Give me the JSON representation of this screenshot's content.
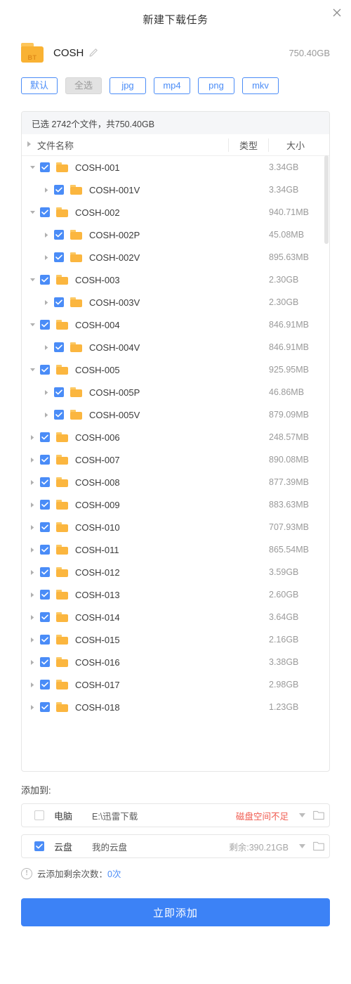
{
  "dialog": {
    "title": "新建下载任务",
    "close_icon": "close-icon"
  },
  "torrent": {
    "icon_label": "BT",
    "name": "COSH",
    "edit_icon": "pencil-icon",
    "total_size": "750.40GB"
  },
  "filters": [
    {
      "label": "默认",
      "state": "active"
    },
    {
      "label": "全选",
      "state": "disabled"
    },
    {
      "label": "jpg",
      "state": "normal"
    },
    {
      "label": "mp4",
      "state": "normal"
    },
    {
      "label": "png",
      "state": "normal"
    },
    {
      "label": "mkv",
      "state": "normal"
    }
  ],
  "file_list": {
    "selection_summary": "已选 2742个文件，共750.40GB",
    "columns": {
      "name": "文件名称",
      "type": "类型",
      "size": "大小"
    },
    "rows": [
      {
        "name": "COSH-001",
        "type": "",
        "size": "3.34GB",
        "level": 1,
        "checked": true,
        "expanded": true
      },
      {
        "name": "COSH-001V",
        "type": "",
        "size": "3.34GB",
        "level": 2,
        "checked": true,
        "expanded": false
      },
      {
        "name": "COSH-002",
        "type": "",
        "size": "940.71MB",
        "level": 1,
        "checked": true,
        "expanded": true
      },
      {
        "name": "COSH-002P",
        "type": "",
        "size": "45.08MB",
        "level": 2,
        "checked": true,
        "expanded": false
      },
      {
        "name": "COSH-002V",
        "type": "",
        "size": "895.63MB",
        "level": 2,
        "checked": true,
        "expanded": false
      },
      {
        "name": "COSH-003",
        "type": "",
        "size": "2.30GB",
        "level": 1,
        "checked": true,
        "expanded": true
      },
      {
        "name": "COSH-003V",
        "type": "",
        "size": "2.30GB",
        "level": 2,
        "checked": true,
        "expanded": false
      },
      {
        "name": "COSH-004",
        "type": "",
        "size": "846.91MB",
        "level": 1,
        "checked": true,
        "expanded": true
      },
      {
        "name": "COSH-004V",
        "type": "",
        "size": "846.91MB",
        "level": 2,
        "checked": true,
        "expanded": false
      },
      {
        "name": "COSH-005",
        "type": "",
        "size": "925.95MB",
        "level": 1,
        "checked": true,
        "expanded": true
      },
      {
        "name": "COSH-005P",
        "type": "",
        "size": "46.86MB",
        "level": 2,
        "checked": true,
        "expanded": false
      },
      {
        "name": "COSH-005V",
        "type": "",
        "size": "879.09MB",
        "level": 2,
        "checked": true,
        "expanded": false
      },
      {
        "name": "COSH-006",
        "type": "",
        "size": "248.57MB",
        "level": 1,
        "checked": true,
        "expanded": false
      },
      {
        "name": "COSH-007",
        "type": "",
        "size": "890.08MB",
        "level": 1,
        "checked": true,
        "expanded": false
      },
      {
        "name": "COSH-008",
        "type": "",
        "size": "877.39MB",
        "level": 1,
        "checked": true,
        "expanded": false
      },
      {
        "name": "COSH-009",
        "type": "",
        "size": "883.63MB",
        "level": 1,
        "checked": true,
        "expanded": false
      },
      {
        "name": "COSH-010",
        "type": "",
        "size": "707.93MB",
        "level": 1,
        "checked": true,
        "expanded": false
      },
      {
        "name": "COSH-011",
        "type": "",
        "size": "865.54MB",
        "level": 1,
        "checked": true,
        "expanded": false
      },
      {
        "name": "COSH-012",
        "type": "",
        "size": "3.59GB",
        "level": 1,
        "checked": true,
        "expanded": false
      },
      {
        "name": "COSH-013",
        "type": "",
        "size": "2.60GB",
        "level": 1,
        "checked": true,
        "expanded": false
      },
      {
        "name": "COSH-014",
        "type": "",
        "size": "3.64GB",
        "level": 1,
        "checked": true,
        "expanded": false
      },
      {
        "name": "COSH-015",
        "type": "",
        "size": "2.16GB",
        "level": 1,
        "checked": true,
        "expanded": false
      },
      {
        "name": "COSH-016",
        "type": "",
        "size": "3.38GB",
        "level": 1,
        "checked": true,
        "expanded": false
      },
      {
        "name": "COSH-017",
        "type": "",
        "size": "2.98GB",
        "level": 1,
        "checked": true,
        "expanded": false
      },
      {
        "name": "COSH-018",
        "type": "",
        "size": "1.23GB",
        "level": 1,
        "checked": true,
        "expanded": false
      }
    ]
  },
  "destination": {
    "label": "添加到:",
    "options": [
      {
        "kind": "电脑",
        "path": "E:\\迅雷下载",
        "status": "磁盘空间不足",
        "status_type": "warn",
        "checked": false
      },
      {
        "kind": "云盘",
        "path": "我的云盘",
        "status": "剩余:390.21GB",
        "status_type": "muted",
        "checked": true
      }
    ]
  },
  "quota": {
    "text": "云添加剩余次数：",
    "count": "0次"
  },
  "submit": {
    "label": "立即添加"
  },
  "colors": {
    "accent": "#3c82f6",
    "chip_border": "#4a8cf7",
    "folder": "#fbb63f",
    "warn": "#f05a4f",
    "muted": "#9a9a9a"
  }
}
